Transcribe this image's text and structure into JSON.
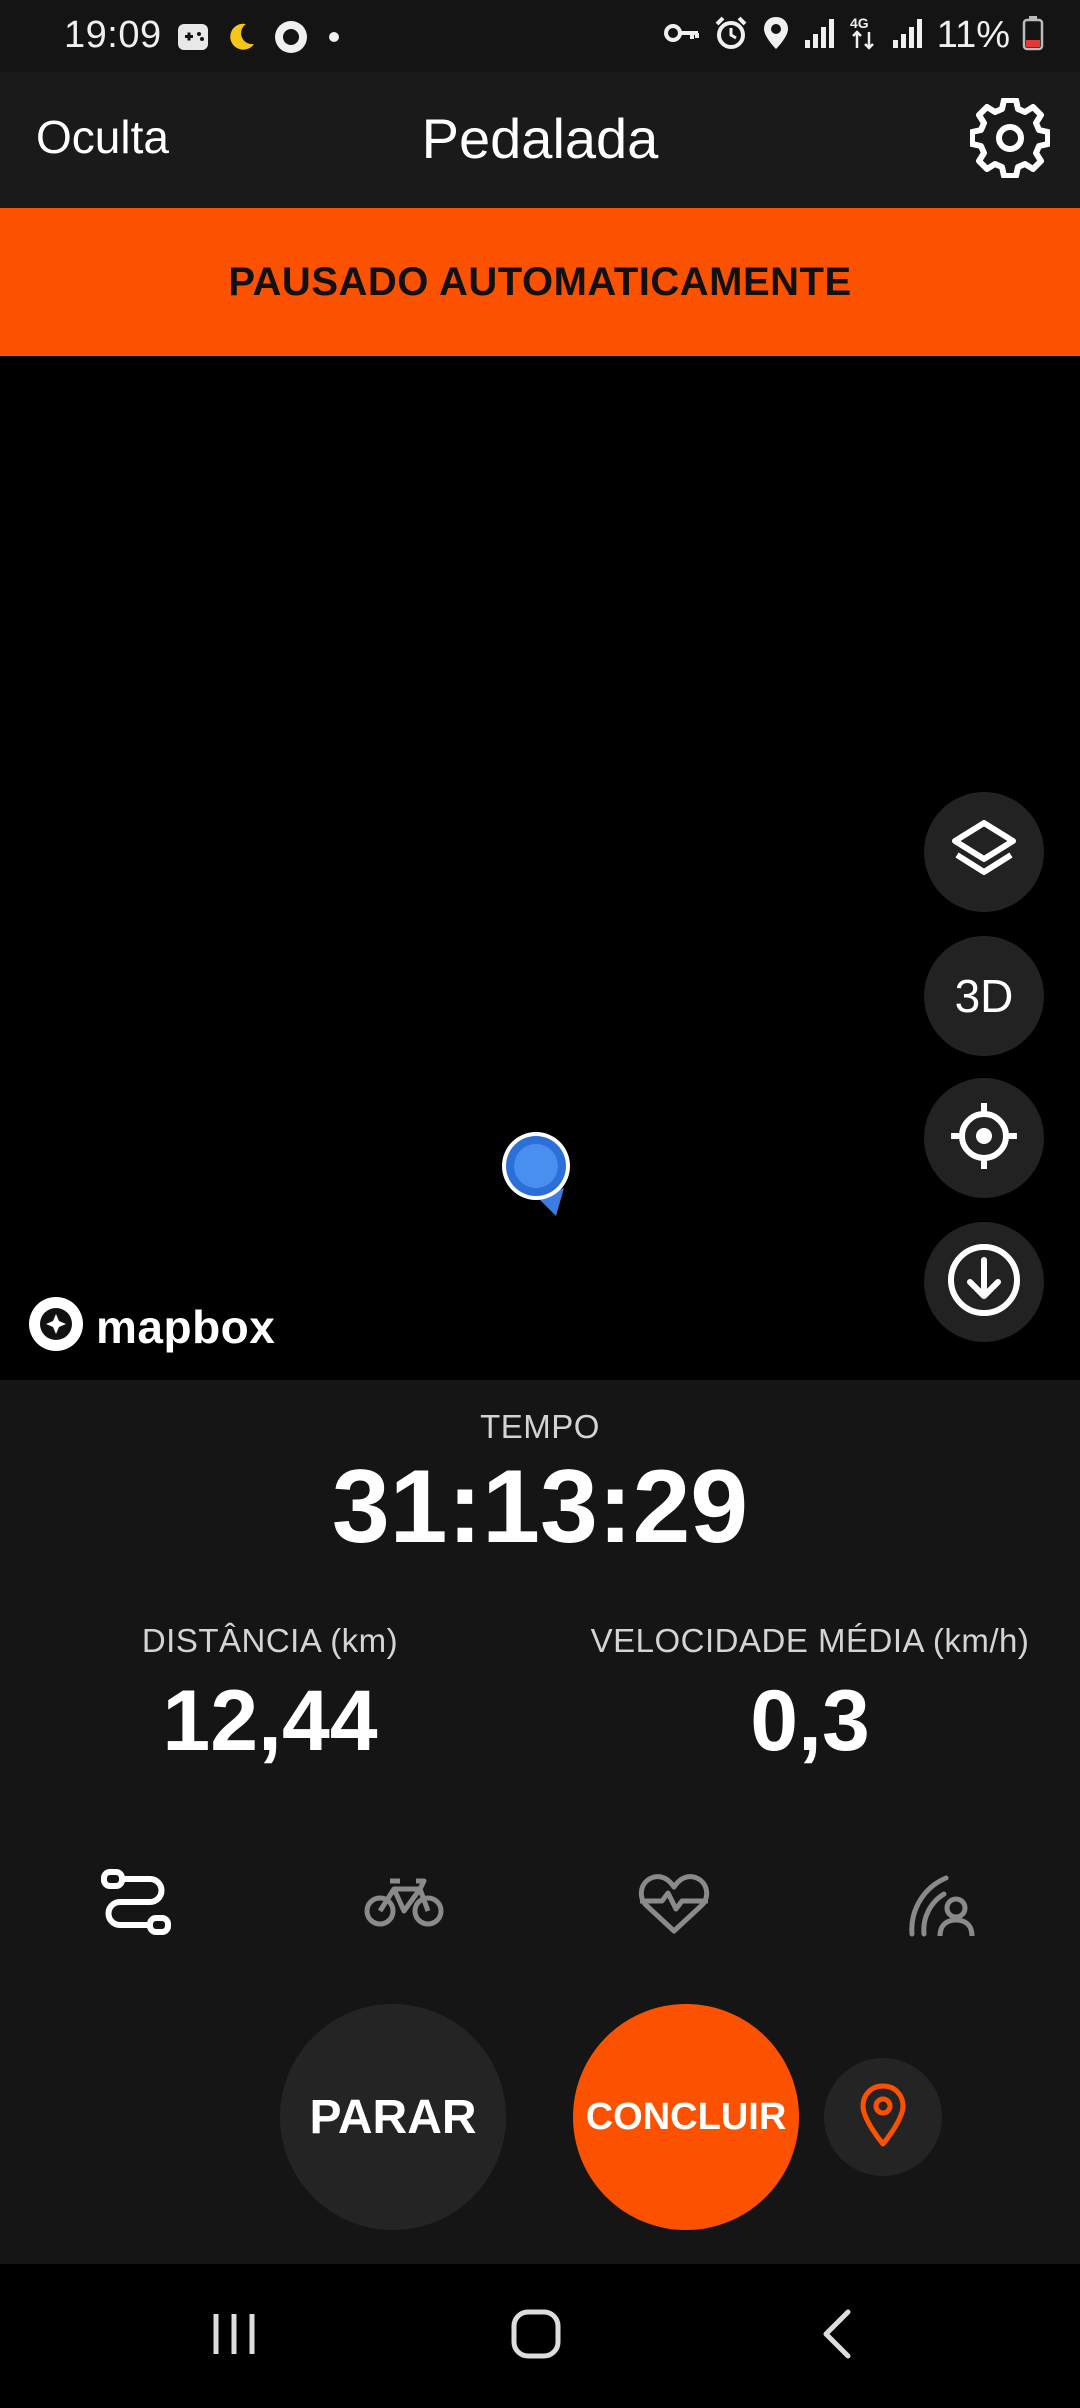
{
  "status_bar": {
    "time": "19:09",
    "battery": "11%",
    "left_icons": [
      "game-icon",
      "moon-icon",
      "record-icon",
      "dot-icon"
    ],
    "right_icons": [
      "key-icon",
      "alarm-icon",
      "location-icon",
      "signal-icon",
      "4g-data-icon",
      "signal-icon",
      "battery-icon"
    ]
  },
  "top_bar": {
    "hide_label": "Oculta",
    "title": "Pedalada",
    "settings_icon": "gear-icon"
  },
  "banner": {
    "text": "PAUSADO AUTOMATICAMENTE",
    "color": "#fc5200"
  },
  "map": {
    "controls": [
      "layers-icon",
      "3D",
      "crosshair-icon",
      "download-icon"
    ],
    "three_d_label": "3D",
    "attribution": "mapbox"
  },
  "stats": {
    "time_label": "TEMPO",
    "time_value": "31:13:29",
    "distance_label": "DISTÂNCIA (km)",
    "distance_value": "12,44",
    "speed_label": "VELOCIDADE MÉDIA (km/h)",
    "speed_value": "0,3"
  },
  "tabs": [
    "route-icon",
    "bike-icon",
    "heart-rate-icon",
    "beacon-icon"
  ],
  "actions": {
    "stop_label": "PARAR",
    "finish_label": "CONCLUIR",
    "pin_icon": "location-pin-icon",
    "accent": "#fc5200"
  },
  "nav": [
    "recents-icon",
    "home-icon",
    "back-icon"
  ]
}
